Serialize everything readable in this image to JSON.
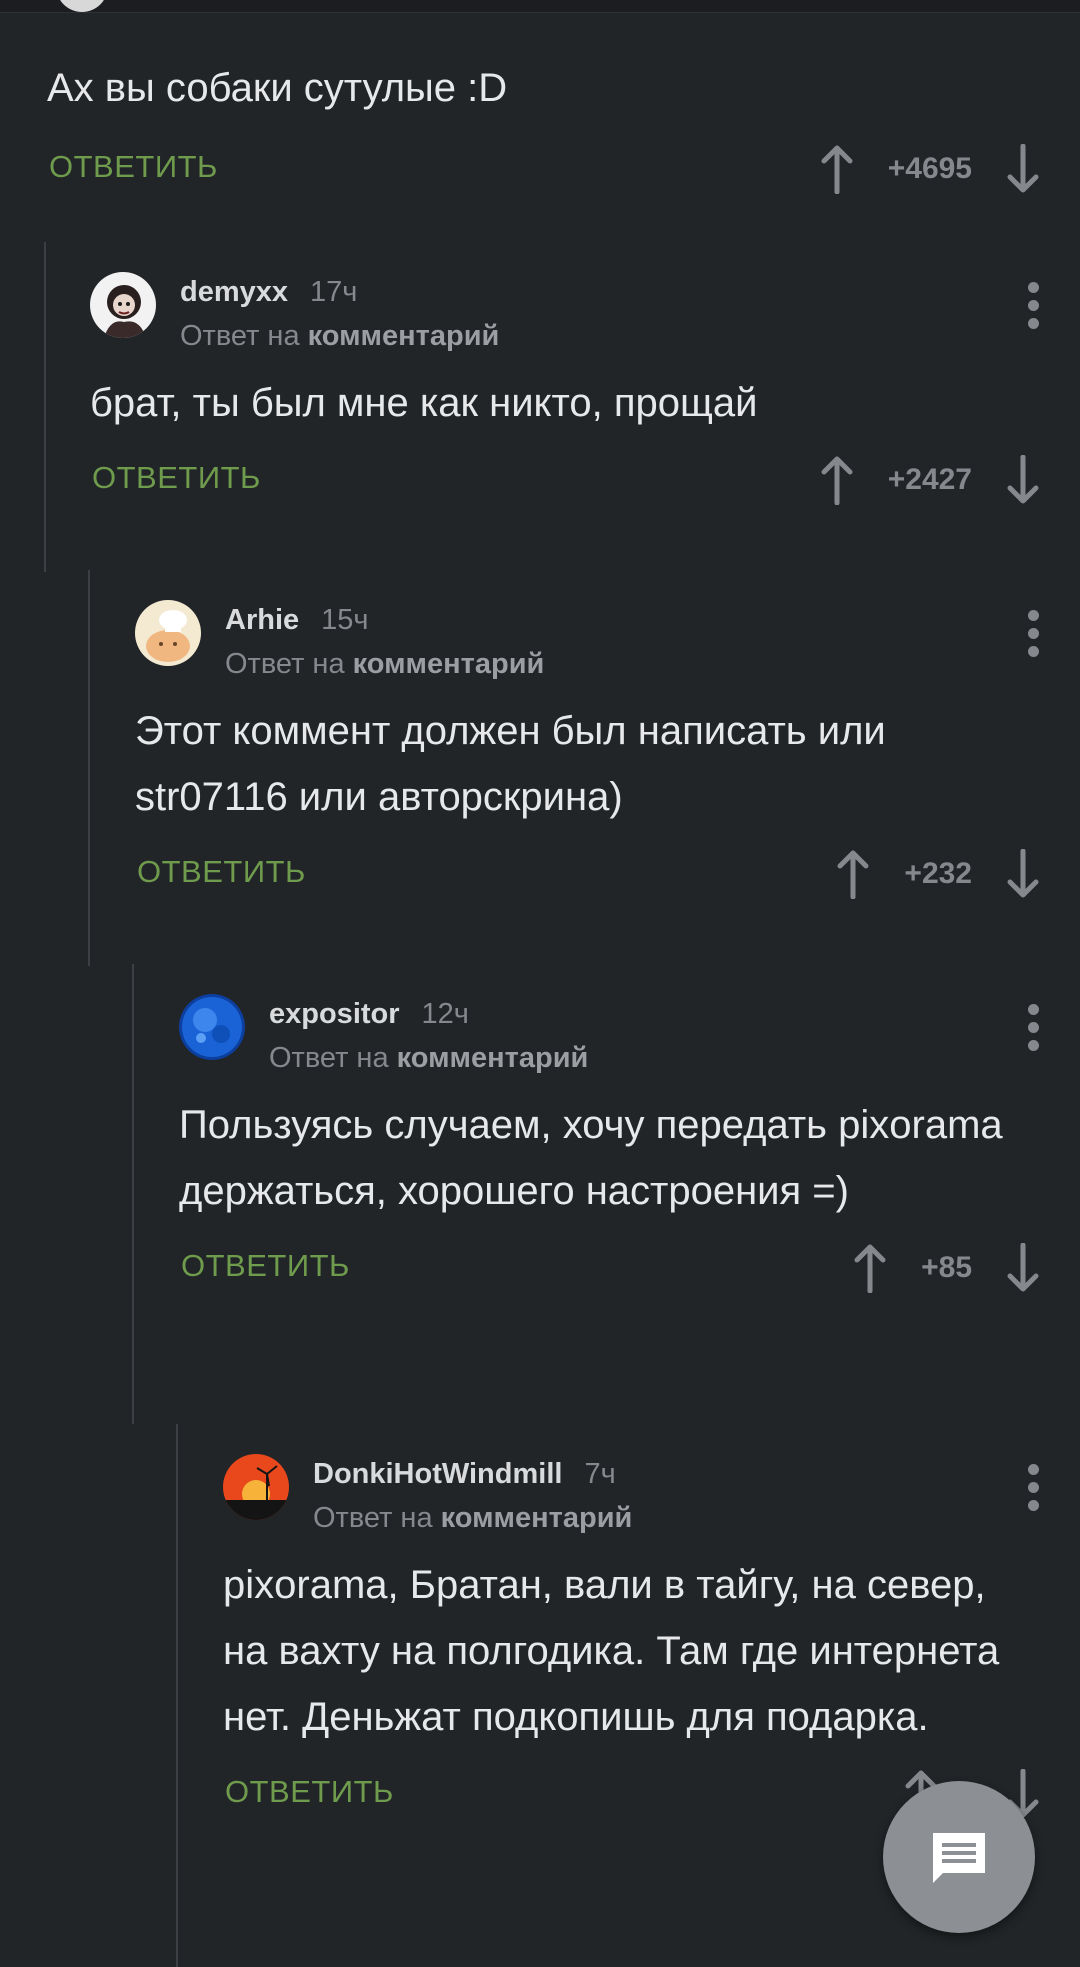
{
  "colors": {
    "background": "#222528",
    "reply_green": "#6f9b4c",
    "muted_text": "#85898e",
    "thread_line": "#3c4045"
  },
  "comments": [
    {
      "body": "Ах вы собаки сутулые :D",
      "reply_label": "ОТВЕТИТЬ",
      "score": "+4695"
    },
    {
      "author": "demyxx",
      "time": "17ч",
      "reply_to_prefix": "Ответ на",
      "reply_to_target": "комментарий",
      "body": "брат, ты был мне как никто, прощай",
      "reply_label": "ОТВЕТИТЬ",
      "score": "+2427"
    },
    {
      "author": "Arhie",
      "time": "15ч",
      "reply_to_prefix": "Ответ на",
      "reply_to_target": "комментарий",
      "body": "Этот коммент должен был написать или str07116 или авторскрина)",
      "reply_label": "ОТВЕТИТЬ",
      "score": "+232"
    },
    {
      "author": "expositor",
      "time": "12ч",
      "reply_to_prefix": "Ответ на",
      "reply_to_target": "комментарий",
      "body": "Пользуясь случаем, хочу передать pixorama держаться, хорошего настроения =)",
      "reply_label": "ОТВЕТИТЬ",
      "score": "+85"
    },
    {
      "author": "DonkiHotWindmill",
      "time": "7ч",
      "reply_to_prefix": "Ответ на",
      "reply_to_target": "комментарий",
      "body": "pixorama, Братан, вали в тайгу, на север, на вахту на полгодика. Там где интернета нет. Деньжат подкопишь для подарка.",
      "reply_label": "ОТВЕТИТЬ"
    }
  ],
  "icons": {
    "upvote": "arrow-up-icon",
    "downvote": "arrow-down-icon",
    "more": "more-vertical-icon",
    "fab": "comment-icon"
  }
}
